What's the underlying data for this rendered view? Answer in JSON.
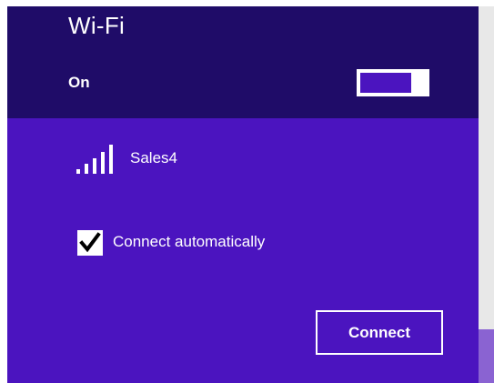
{
  "header": {
    "title": "Wi-Fi",
    "state_label": "On",
    "toggle_on": true
  },
  "network": {
    "name": "Sales4",
    "signal_icon": "wifi-signal-bars-icon",
    "signal_strength_bars": 5
  },
  "auto_connect": {
    "label": "Connect automatically",
    "checked": true
  },
  "connect_button": {
    "label": "Connect"
  },
  "colors": {
    "header_bg": "#1f0c68",
    "body_bg": "#4b14bf",
    "scroll_thumb": "#8a63d2",
    "text": "#ffffff"
  }
}
